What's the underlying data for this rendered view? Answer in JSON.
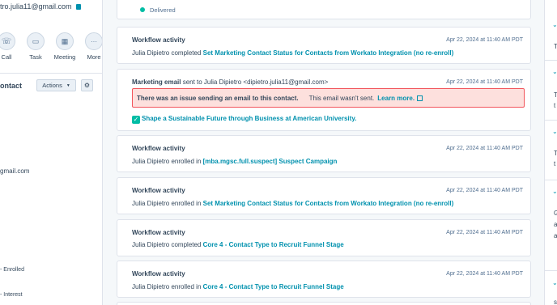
{
  "left": {
    "email": "tro.julia11@gmail.com",
    "actions": [
      {
        "label": "Call",
        "icon": "☏"
      },
      {
        "label": "Task",
        "icon": "▭"
      },
      {
        "label": "Meeting",
        "icon": "▦"
      },
      {
        "label": "More",
        "icon": "···"
      }
    ],
    "contact_title": "ontact",
    "actions_button": "Actions",
    "email_partial": "gmail.com",
    "enrolled_text": "- Enrolled",
    "interest_text": "- Interest"
  },
  "feed": {
    "delivered": "Delivered",
    "items": [
      {
        "title": "Workflow activity",
        "date": "Apr 22, 2024 at 11:40 AM PDT",
        "actor": "Julia Dipietro",
        "verb": " completed ",
        "link": "Set Marketing Contact Status for Contacts from Workato Integration (no re-enroll)"
      },
      {
        "title": "Workflow activity",
        "date": "Apr 22, 2024 at 11:40 AM PDT",
        "actor": "Julia Dipietro",
        "verb": " enrolled in ",
        "link": "[mba.mgsc.full.suspect] Suspect Campaign"
      },
      {
        "title": "Workflow activity",
        "date": "Apr 22, 2024 at 11:40 AM PDT",
        "actor": "Julia Dipietro",
        "verb": " enrolled in ",
        "link": "Set Marketing Contact Status for Contacts from Workato Integration (no re-enroll)"
      },
      {
        "title": "Workflow activity",
        "date": "Apr 22, 2024 at 11:40 AM PDT",
        "actor": "Julia Dipietro",
        "verb": " completed ",
        "link": "Core 4 - Contact Type to Recruit Funnel Stage"
      },
      {
        "title": "Workflow activity",
        "date": "Apr 22, 2024 at 11:40 AM PDT",
        "actor": "Julia Dipietro",
        "verb": " enrolled in ",
        "link": "Core 4 - Contact Type to Recruit Funnel Stage"
      }
    ],
    "email_card": {
      "title": "Marketing email",
      "subtitle": " sent to Julia Dipietro <dipietro.julia11@gmail.com>",
      "date": "Apr 22, 2024 at 11:40 AM PDT",
      "alert_bold": "There was an issue sending an email to this contact.",
      "alert_text": "This email wasn't sent.",
      "alert_link": "Learn more.",
      "email_name": "Shape a Sustainable Future through Business at American University."
    }
  },
  "right": {
    "letters": [
      "T",
      "T",
      "t",
      "T",
      "t",
      "G",
      "a",
      "a",
      "s"
    ]
  },
  "colors": {
    "accent": "#0091ae",
    "success": "#00bda5",
    "error_bg": "#fde0dd",
    "error_border": "#f2545b"
  }
}
